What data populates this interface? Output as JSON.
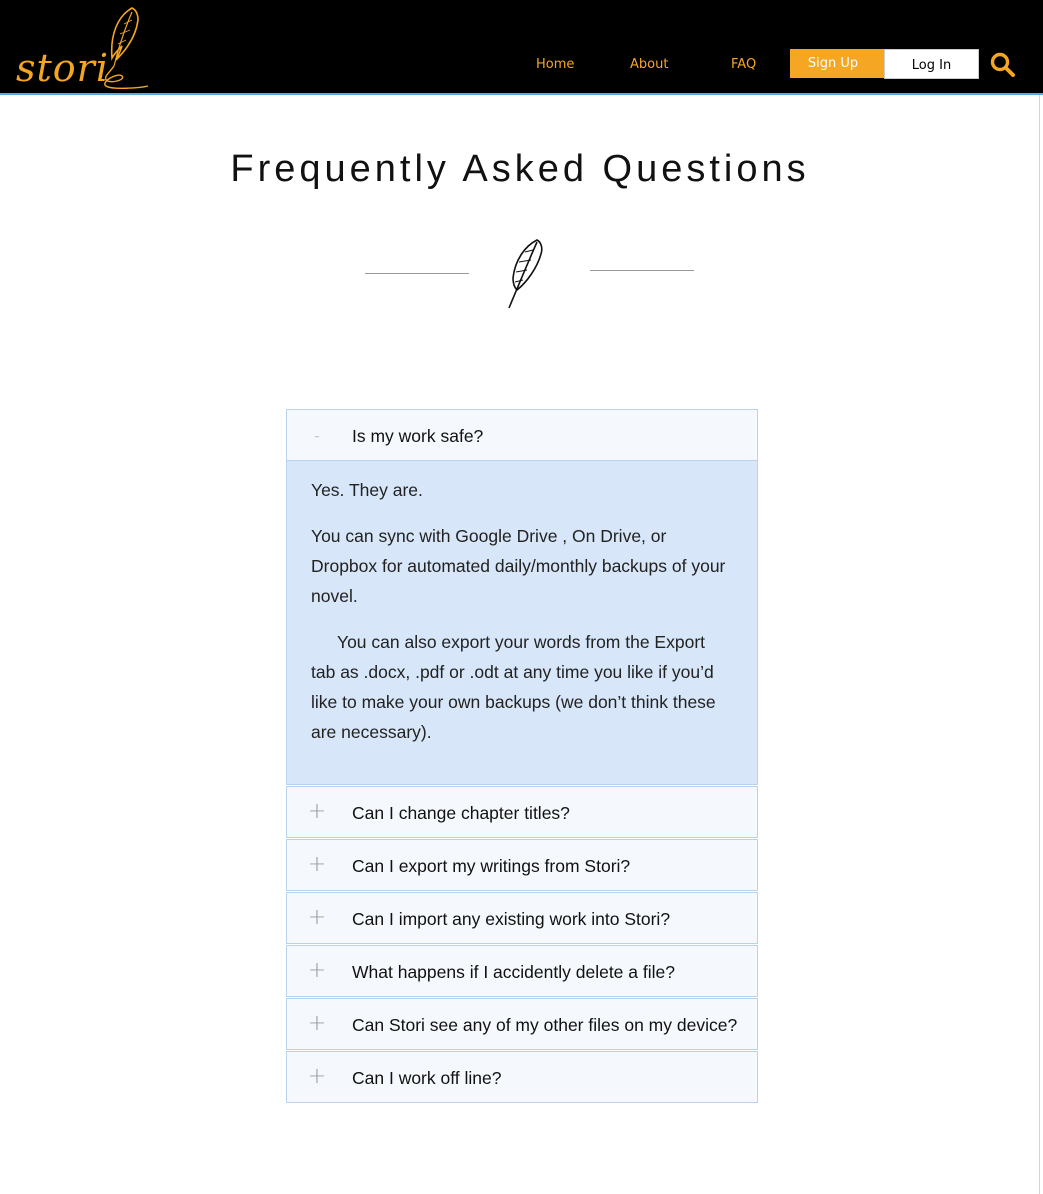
{
  "header": {
    "logo_text": "stori",
    "nav": {
      "home": "Home",
      "about": "About",
      "faq": "FAQ"
    },
    "signup_label": "Sign Up",
    "login_label": "Log In",
    "search_icon": "search-icon",
    "accent_color": "#f5a623"
  },
  "main": {
    "title": "Frequently Asked Questions",
    "divider_icon": "feather-icon"
  },
  "faq": {
    "items": [
      {
        "question": "Is my work safe?",
        "toggle": "-",
        "expanded": true,
        "answer": [
          "Yes. They are.",
          "You can sync with Google Drive , On Drive, or Dropbox for automated daily/monthly backups of your novel.",
          "You can also export your words from the Export tab as .docx, .pdf or .odt at any time you like if you’d like to make your own backups (we don’t think these are necessary)."
        ]
      },
      {
        "question": "Can I change chapter titles?",
        "toggle": "+",
        "expanded": false
      },
      {
        "question": "Can I export my writings from Stori?",
        "toggle": "+",
        "expanded": false
      },
      {
        "question": "Can I import any existing work into Stori?",
        "toggle": "+",
        "expanded": false
      },
      {
        "question": "What happens if I accidently delete a file?",
        "toggle": "+",
        "expanded": false
      },
      {
        "question": "Can Stori see any of my other files on my device?",
        "toggle": "+",
        "expanded": false
      },
      {
        "question": "Can I work off line?",
        "toggle": "+",
        "expanded": false
      }
    ]
  }
}
